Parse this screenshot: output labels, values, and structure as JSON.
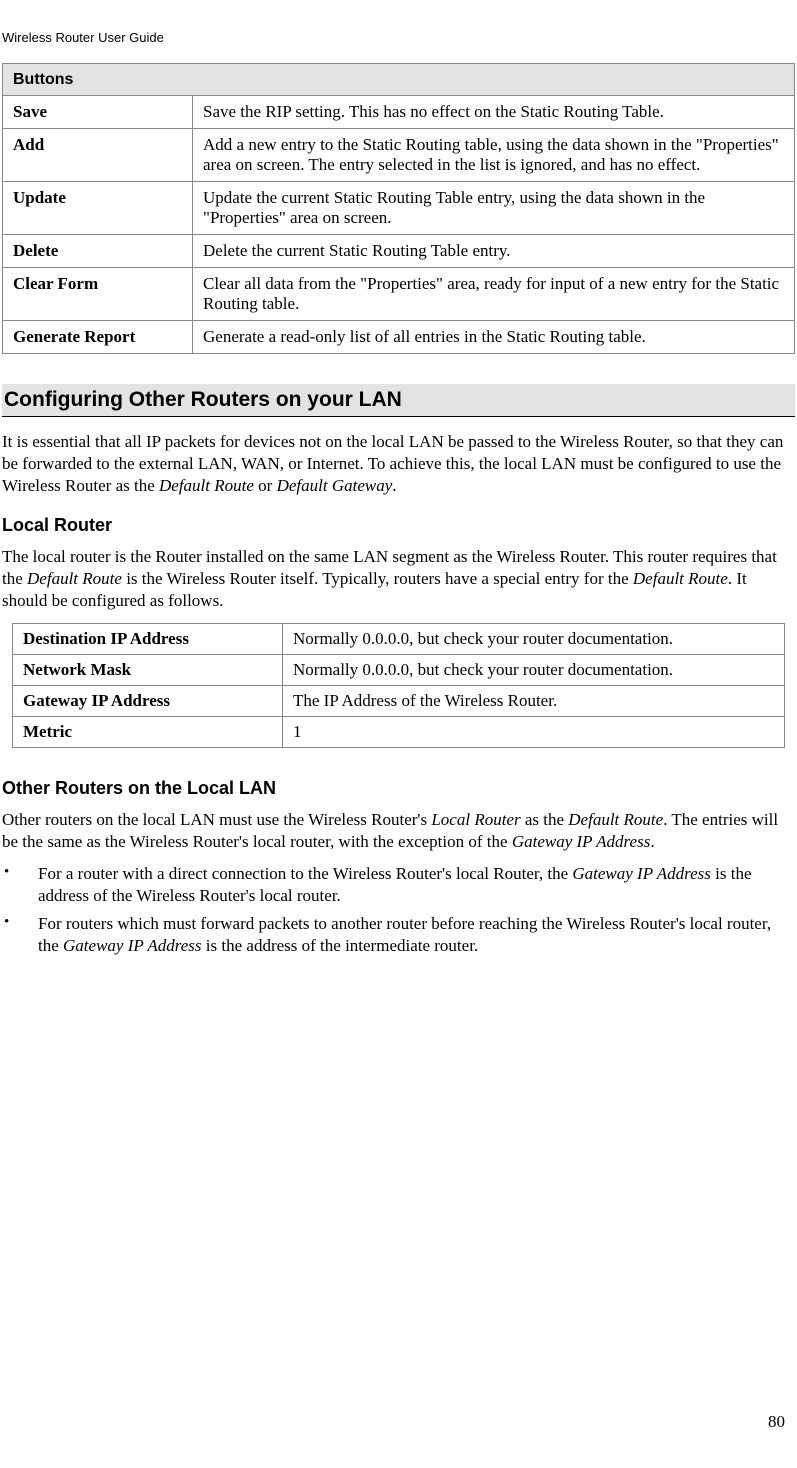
{
  "header": "Wireless Router User Guide",
  "buttons_table": {
    "header": "Buttons",
    "rows": [
      {
        "label": "Save",
        "desc": "Save the RIP setting. This has no effect on the Static Routing Table."
      },
      {
        "label": "Add",
        "desc": "Add a new entry to the Static Routing table, using the data shown in the \"Properties\" area on screen. The entry selected in the list is ignored, and has no effect."
      },
      {
        "label": "Update",
        "desc": "Update the current Static Routing Table entry, using the data shown in the \"Properties\" area on screen."
      },
      {
        "label": "Delete",
        "desc": "Delete the current Static Routing Table entry."
      },
      {
        "label": "Clear Form",
        "desc": "Clear all data from the \"Properties\" area, ready for input of a new entry for the Static Routing table."
      },
      {
        "label": "Generate Report",
        "desc": "Generate a read-only list of all entries in the Static Routing table."
      }
    ]
  },
  "section_title": "Configuring Other Routers on your LAN",
  "section_intro": {
    "pre": "It is essential that all IP packets for devices not on the local LAN be passed to the Wireless Router, so that they can be forwarded to the external LAN, WAN, or Internet. To achieve this, the local LAN must be configured to use the Wireless Router as the ",
    "em1": "Default Route",
    "mid": " or ",
    "em2": "Default Gateway",
    "post": "."
  },
  "local_router": {
    "title": "Local Router",
    "intro": {
      "pre": "The local router is the Router installed on the same LAN segment as the Wireless Router. This router requires that the ",
      "em1": "Default Route",
      "mid1": " is the Wireless Router itself. Typically, routers have a special entry for the ",
      "em2": "Default Route",
      "post": ". It should be configured as follows."
    },
    "rows": [
      {
        "label": "Destination IP Address",
        "desc": "Normally 0.0.0.0, but check your router documentation."
      },
      {
        "label": "Network Mask",
        "desc": "Normally 0.0.0.0, but check your router documentation."
      },
      {
        "label": "Gateway IP Address",
        "desc": "The IP Address of the Wireless Router."
      },
      {
        "label": "Metric",
        "desc": "1"
      }
    ]
  },
  "other_routers": {
    "title": "Other Routers on the Local LAN",
    "intro": {
      "pre": "Other routers on the local LAN must use the Wireless Router's ",
      "em1": "Local Router",
      "mid": " as the ",
      "em2": "Default Route",
      "post1": ". The entries will be the same as the Wireless Router's local router, with the exception of the ",
      "em3": "Gateway IP Address",
      "post2": "."
    },
    "bullets": [
      {
        "pre": "For a router with a direct connection to the Wireless Router's local Router, the ",
        "em1": "Gateway IP Address",
        "post": " is the address of the Wireless Router's local router."
      },
      {
        "pre": "For routers which must forward packets to another router before reaching the Wireless Router's local router, the ",
        "em1": "Gateway IP Address",
        "post": " is the address of the intermediate router."
      }
    ]
  },
  "page_number": "80"
}
